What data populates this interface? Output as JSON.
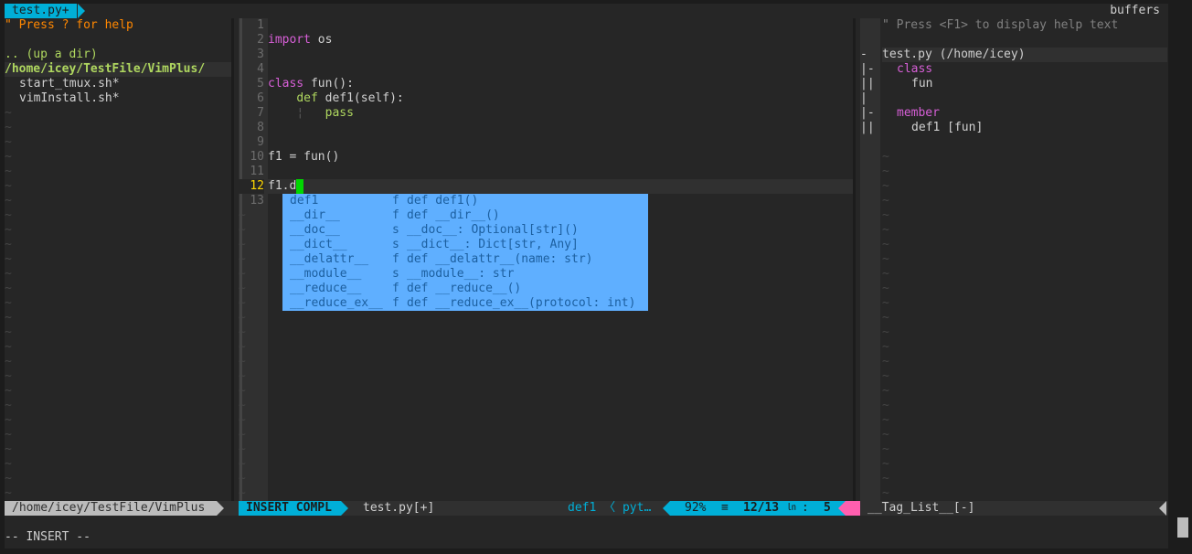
{
  "tabline": {
    "active_tab": "test.py+",
    "right_label": "buffers"
  },
  "nerdtree": {
    "help": "\" Press ? for help",
    "up_dir": ".. (up a dir)",
    "root": "/home/icey/TestFile/VimPlus/",
    "files": [
      "start_tmux.sh*",
      "vimInstall.sh*"
    ],
    "tilde": "~"
  },
  "editor": {
    "lines": [
      {
        "num": "1",
        "parts": []
      },
      {
        "num": "2",
        "parts": [
          {
            "t": "import",
            "c": "kw"
          },
          {
            "t": " os",
            "c": ""
          }
        ]
      },
      {
        "num": "3",
        "parts": []
      },
      {
        "num": "4",
        "parts": []
      },
      {
        "num": "5",
        "parts": [
          {
            "t": "class",
            "c": "kw"
          },
          {
            "t": " fun():",
            "c": ""
          }
        ]
      },
      {
        "num": "6",
        "parts": [
          {
            "t": "    ",
            "c": ""
          },
          {
            "t": "def",
            "c": "fn-kw"
          },
          {
            "t": " def1(self):",
            "c": ""
          }
        ]
      },
      {
        "num": "7",
        "parts": [
          {
            "t": "    ",
            "c": ""
          },
          {
            "t": "¦",
            "c": "indent-guide"
          },
          {
            "t": "   ",
            "c": ""
          },
          {
            "t": "pass",
            "c": "fn-kw"
          }
        ]
      },
      {
        "num": "8",
        "parts": []
      },
      {
        "num": "9",
        "parts": []
      },
      {
        "num": "10",
        "parts": [
          {
            "t": "f1 = fun()",
            "c": ""
          }
        ]
      },
      {
        "num": "11",
        "parts": []
      },
      {
        "num": "12",
        "parts": [
          {
            "t": "f1.d",
            "c": ""
          }
        ]
      },
      {
        "num": "13",
        "parts": []
      }
    ],
    "current_line": "12"
  },
  "completion": {
    "items": [
      {
        "word": "def1",
        "kind": "f",
        "sig": "def def1()"
      },
      {
        "word": "__dir__",
        "kind": "f",
        "sig": "def __dir__()"
      },
      {
        "word": "__doc__",
        "kind": "s",
        "sig": "__doc__: Optional[str]()"
      },
      {
        "word": "__dict__",
        "kind": "s",
        "sig": "__dict__: Dict[str, Any]"
      },
      {
        "word": "__delattr__",
        "kind": "f",
        "sig": "def __delattr__(name: str)"
      },
      {
        "word": "__module__",
        "kind": "s",
        "sig": "__module__: str"
      },
      {
        "word": "__reduce__",
        "kind": "f",
        "sig": "def __reduce__()"
      },
      {
        "word": "__reduce_ex__",
        "kind": "f",
        "sig": "def __reduce_ex__(protocol: int)"
      }
    ]
  },
  "taglist": {
    "help": "\" Press <F1> to display help text",
    "file_entry": "test.py (/home/icey)",
    "class_label": "class",
    "class_item": "fun",
    "member_label": "member",
    "member_item": "def1 [fun]",
    "signs": [
      "-",
      "|-",
      "||",
      "|",
      "|-",
      "||"
    ]
  },
  "statusline": {
    "nerd_path": "/home/icey/TestFile/VimPlus",
    "mode": "INSERT COMPL",
    "file": "test.py[+]",
    "tag": "def1",
    "tag_sep": "〈",
    "filetype": "pyt…",
    "percent": "92%",
    "equiv": "≡",
    "position": "12/13",
    "ln_symbol": "㏑",
    "col_sep": ":",
    "col": "5",
    "taglist_name": "__Tag_List__[-]"
  },
  "cmdline": {
    "text": "-- INSERT --"
  },
  "colors": {
    "accent": "#00afd7",
    "popup_bg": "#5fafff",
    "cursor": "#00d700",
    "warning": "#ff5faf"
  }
}
